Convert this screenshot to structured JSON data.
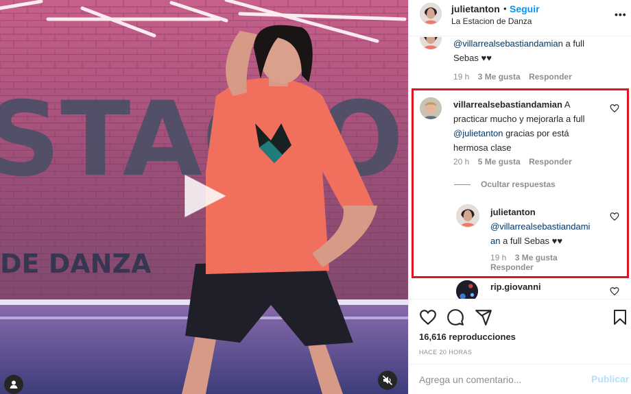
{
  "post": {
    "username": "julietanton",
    "follow_label": "Seguir",
    "location": "La Estacion de Danza",
    "more_icon": "more-horizontal-icon"
  },
  "media": {
    "wall_text_1": "STACIO",
    "wall_text_2": "DE DANZA",
    "play_icon": "play-icon",
    "tag_icon": "user-tag-icon",
    "mute_icon": "muted-speaker-icon"
  },
  "comments": {
    "top_partial": {
      "mention": "@villarrealsebastiandamian",
      "text": " a full Sebas ♥♥",
      "time": "19 h",
      "likes": "3 Me gusta",
      "reply_label": "Responder"
    },
    "main": {
      "username": "villarrealsebastiandamian",
      "text_1": " A practicar mucho y mejorarla a full ",
      "mention": "@julietanton",
      "text_2": " gracias por está hermosa clase",
      "time": "20 h",
      "likes": "5 Me gusta",
      "reply_label": "Responder"
    },
    "hide_replies_label": "Ocultar respuestas",
    "reply": {
      "username": "julietanton",
      "mention_line_1": "@villarrealsebastiandami",
      "mention_line_2": "an",
      "text": " a full Sebas ♥♥",
      "time": "19 h",
      "likes": "3 Me gusta",
      "reply_label": "Responder"
    },
    "next": {
      "username": "rip.giovanni"
    }
  },
  "actions": {
    "views": "16,616 reproducciones",
    "time_ago": "HACE 20 HORAS"
  },
  "composer": {
    "placeholder": "Agrega un comentario...",
    "post_label": "Publicar"
  },
  "colors": {
    "accent": "#0095f6",
    "highlight": "#e0141e",
    "mention": "#00376b",
    "muted": "#8e8e8e"
  }
}
